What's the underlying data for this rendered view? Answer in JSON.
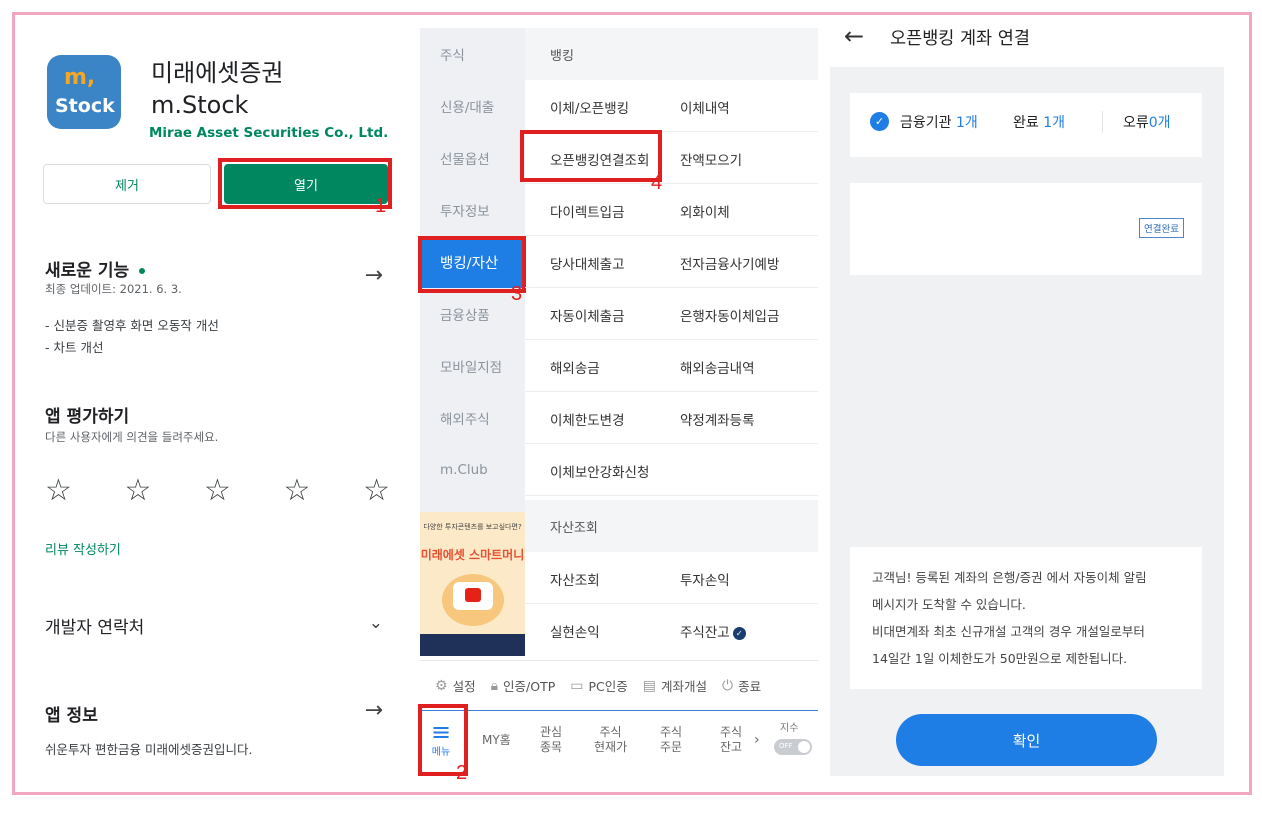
{
  "playstore": {
    "app_name": "미래에셋증권",
    "app_name2": "m.Stock",
    "developer": "Mirae Asset Securities Co., Ltd.",
    "icon_text_top": "m,",
    "icon_text_bottom": "Stock",
    "remove_label": "제거",
    "open_label": "열기",
    "whats_new_title": "새로운 기능",
    "last_update": "최종 업데이트: 2021. 6. 3.",
    "whats_new_body1": "- 신분증 촬영후 화면 오동작 개선",
    "whats_new_body2": "- 차트 개선",
    "rate_title": "앱 평가하기",
    "rate_sub": "다른 사용자에게 의견을 들려주세요.",
    "star_glyph": "☆",
    "review_link": "리뷰 작성하기",
    "dev_contact": "개발자 연락처",
    "app_info_title": "앱 정보",
    "app_info_body": "쉬운투자 편한금융 미래에셋증권입니다.",
    "accent_color": "#01875f"
  },
  "menu": {
    "side_items": [
      "주식",
      "신용/대출",
      "선물옵션",
      "투자정보",
      "뱅킹/자산",
      "금융상품",
      "모바일지점",
      "해외주식",
      "m.Club"
    ],
    "active_item": "뱅킹/자산",
    "ad_text1": "다양한 투자콘텐츠를 보고싶다면?",
    "ad_text2": "미래에셋 스마트머니",
    "sections": {
      "banking": "뱅킹",
      "assets": "자산조회"
    },
    "banking_rows": [
      [
        "이체/오픈뱅킹",
        "이체내역"
      ],
      [
        "오픈뱅킹연결조회",
        "잔액모으기"
      ],
      [
        "다이렉트입금",
        "외화이체"
      ],
      [
        "당사대체출고",
        "전자금융사기예방"
      ],
      [
        "자동이체출금",
        "은행자동이체입금"
      ],
      [
        "해외송금",
        "해외송금내역"
      ],
      [
        "이체한도변경",
        "약정계좌등록"
      ],
      [
        "이체보안강화신청",
        ""
      ]
    ],
    "asset_rows": [
      [
        "자산조회",
        "투자손익"
      ],
      [
        "실현손익",
        "주식잔고"
      ]
    ],
    "toolbar": [
      "설정",
      "인증/OTP",
      "PC인증",
      "계좌개설",
      "종료"
    ],
    "nav_menu_label": "메뉴",
    "nav_items": [
      "MY홈",
      "관심\n종목",
      "주식\n현재가",
      "주식\n주문",
      "주식\n잔고"
    ],
    "toggle_label": "지수",
    "toggle_state": "OFF",
    "accent_color": "#1f7ee5"
  },
  "openbanking": {
    "back_icon": "←",
    "title": "오픈뱅킹 계좌 연결",
    "institutions_label": "금융기관",
    "institutions_count": "1개",
    "done_label": "완료",
    "done_count": "1개",
    "error_label": "오류",
    "error_count": "0개",
    "badge": "연결완료",
    "notice1": "고객님! 등록된 계좌의 은행/증권 에서 자동이체 알림",
    "notice2": "메시지가 도착할 수 있습니다.",
    "notice3": "비대면계좌 최초 신규개설 고객의 경우 개설일로부터",
    "notice4": "14일간 1일 이체한도가 50만원으로 제한됩니다.",
    "confirm_label": "확인"
  },
  "annotations": {
    "step1": "1",
    "step2": "2",
    "step3": "3",
    "step4": "4",
    "highlight_color": "#e02020",
    "frame_color": "#f2a7bf"
  }
}
